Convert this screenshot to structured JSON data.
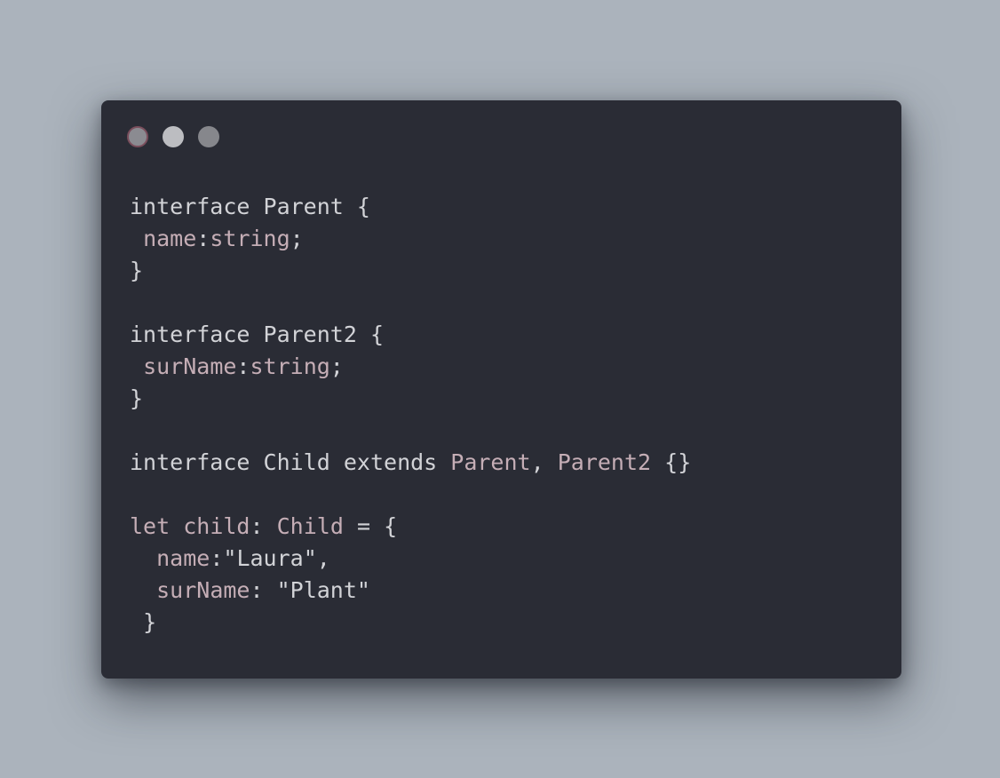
{
  "editor": {
    "lines": [
      [
        {
          "k": "kw",
          "t": "interface"
        },
        {
          "k": "plain",
          "t": " "
        },
        {
          "k": "type",
          "t": "Parent"
        },
        {
          "k": "plain",
          "t": " "
        },
        {
          "k": "punc",
          "t": "{"
        }
      ],
      [
        {
          "k": "ind",
          "t": " "
        },
        {
          "k": "prop",
          "t": "name"
        },
        {
          "k": "punc",
          "t": ":"
        },
        {
          "k": "builtin",
          "t": "string"
        },
        {
          "k": "punc",
          "t": ";"
        }
      ],
      [
        {
          "k": "punc",
          "t": "}"
        }
      ],
      [],
      [
        {
          "k": "kw",
          "t": "interface"
        },
        {
          "k": "plain",
          "t": " "
        },
        {
          "k": "type",
          "t": "Parent2"
        },
        {
          "k": "plain",
          "t": " "
        },
        {
          "k": "punc",
          "t": "{"
        }
      ],
      [
        {
          "k": "ind",
          "t": " "
        },
        {
          "k": "prop",
          "t": "surName"
        },
        {
          "k": "punc",
          "t": ":"
        },
        {
          "k": "builtin",
          "t": "string"
        },
        {
          "k": "punc",
          "t": ";"
        }
      ],
      [
        {
          "k": "punc",
          "t": "}"
        }
      ],
      [],
      [
        {
          "k": "kw",
          "t": "interface"
        },
        {
          "k": "plain",
          "t": " "
        },
        {
          "k": "type",
          "t": "Child"
        },
        {
          "k": "plain",
          "t": " "
        },
        {
          "k": "kw",
          "t": "extends"
        },
        {
          "k": "plain",
          "t": " "
        },
        {
          "k": "ref",
          "t": "Parent"
        },
        {
          "k": "punc",
          "t": ","
        },
        {
          "k": "plain",
          "t": " "
        },
        {
          "k": "ref",
          "t": "Parent2"
        },
        {
          "k": "plain",
          "t": " "
        },
        {
          "k": "punc",
          "t": "{}"
        }
      ],
      [],
      [
        {
          "k": "let",
          "t": "let"
        },
        {
          "k": "plain",
          "t": " "
        },
        {
          "k": "var",
          "t": "child"
        },
        {
          "k": "punc",
          "t": ":"
        },
        {
          "k": "plain",
          "t": " "
        },
        {
          "k": "ref",
          "t": "Child"
        },
        {
          "k": "plain",
          "t": " "
        },
        {
          "k": "punc",
          "t": "="
        },
        {
          "k": "plain",
          "t": " "
        },
        {
          "k": "punc",
          "t": "{"
        }
      ],
      [
        {
          "k": "ind",
          "t": "  "
        },
        {
          "k": "prop",
          "t": "name"
        },
        {
          "k": "punc",
          "t": ":"
        },
        {
          "k": "str",
          "t": "\"Laura\""
        },
        {
          "k": "punc",
          "t": ","
        }
      ],
      [
        {
          "k": "ind",
          "t": "  "
        },
        {
          "k": "prop",
          "t": "surName"
        },
        {
          "k": "punc",
          "t": ":"
        },
        {
          "k": "plain",
          "t": " "
        },
        {
          "k": "str",
          "t": "\"Plant\""
        }
      ],
      [
        {
          "k": "ind",
          "t": " "
        },
        {
          "k": "punc",
          "t": "}"
        }
      ]
    ]
  },
  "theme": {
    "page_background": "#abb3bc",
    "window_background": "#2a2c35",
    "text_color": "#d2d3d7",
    "accent_text_color": "#c5aeb6",
    "window_buttons": {
      "close": "#8b8b91",
      "minimize": "#bcbdc1",
      "maximize": "#86878c"
    }
  }
}
